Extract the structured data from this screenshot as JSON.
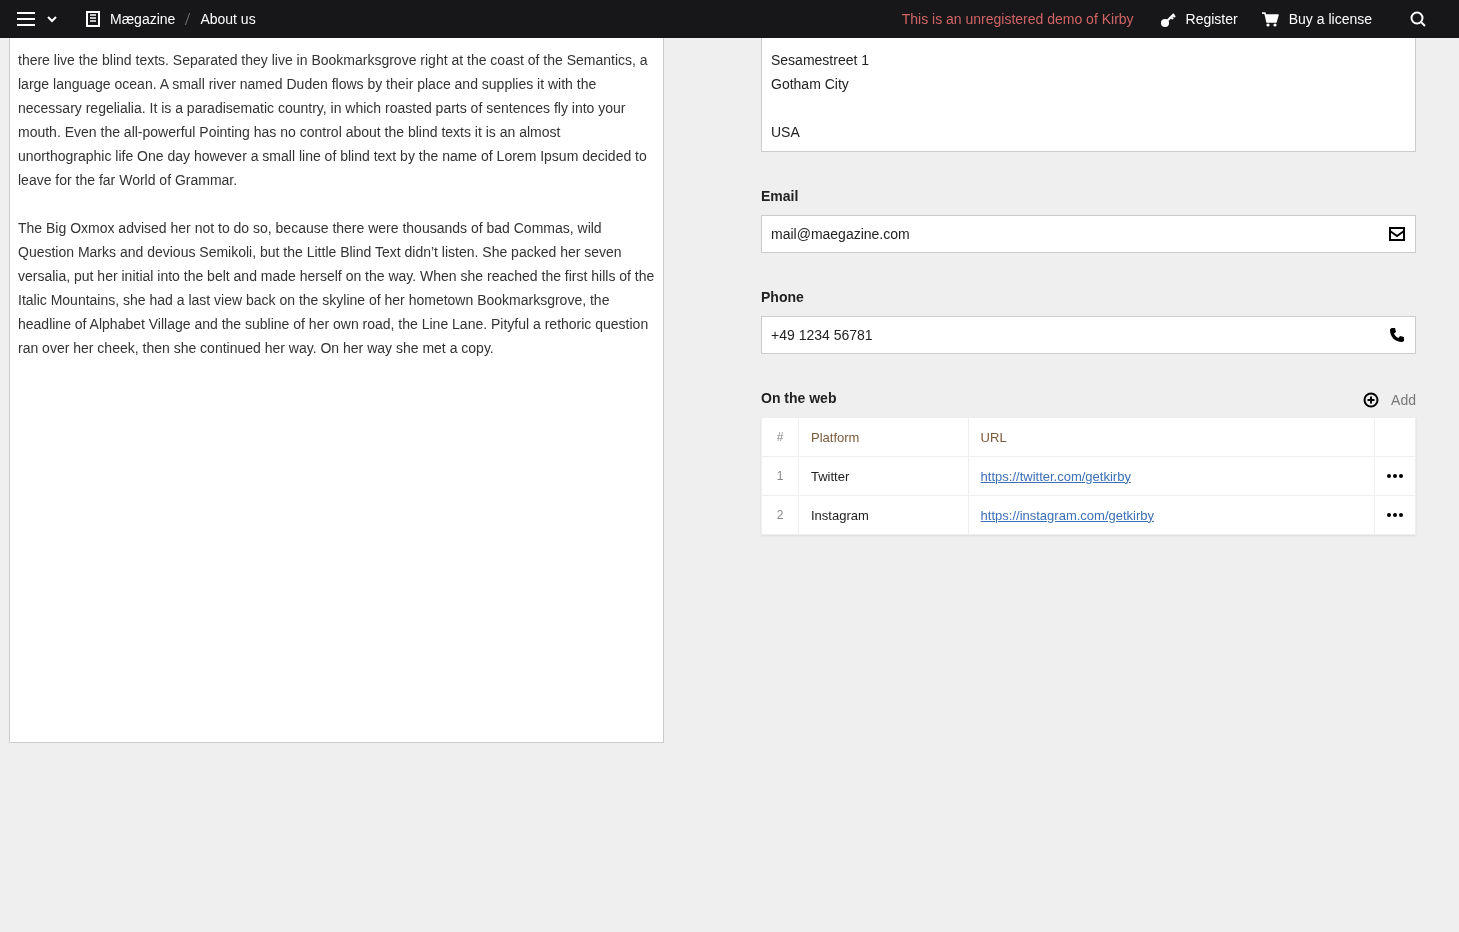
{
  "topbar": {
    "breadcrumb": [
      {
        "label": "Mægazine"
      },
      {
        "label": "About us"
      }
    ],
    "notice": "This is an unregistered demo of Kirby",
    "actions": [
      {
        "kind": "key",
        "label": "Register"
      },
      {
        "kind": "cart",
        "label": "Buy a license"
      }
    ]
  },
  "text_field": {
    "paragraphs": [
      "there live the blind texts. Separated they live in Bookmarksgrove right at the coast of the Semantics, a large language ocean. A small river named Duden flows by their place and supplies it with the necessary regelialia. It is a paradisematic country, in which roasted parts of sentences fly into your mouth. Even the all-powerful Pointing has no control about the blind texts it is an almost unorthographic life One day however a small line of blind text by the name of Lorem Ipsum decided to leave for the far World of Grammar.",
      "The Big Oxmox advised her not to do so, because there were thousands of bad Commas, wild Question Marks and devious Semikoli, but the Little Blind Text didn’t listen. She packed her seven versalia, put her initial into the belt and made herself on the way. When she reached the first hills of the Italic Mountains, she had a last view back on the skyline of her hometown Bookmarksgrove, the headline of Alphabet Village and the subline of her own road, the Line Lane. Pityful a rethoric question ran over her cheek, then she continued her way. On her way she met a copy."
    ]
  },
  "address": {
    "value": "Sesamestreet 1\nGotham City\n\nUSA"
  },
  "fields": [
    {
      "label": "Email",
      "value": "mail@maegazine.com",
      "kind": "email"
    },
    {
      "label": "Phone",
      "value": "+49 1234 56781",
      "kind": "phone"
    }
  ],
  "web": {
    "label": "On the web",
    "add": "Add",
    "columns": [
      "#",
      "Platform",
      "URL"
    ],
    "rows": [
      {
        "index": "1",
        "platform": "Twitter",
        "url": "https://twitter.com/getkirby"
      },
      {
        "index": "2",
        "platform": "Instagram",
        "url": "https://instagram.com/getkirby"
      }
    ]
  }
}
